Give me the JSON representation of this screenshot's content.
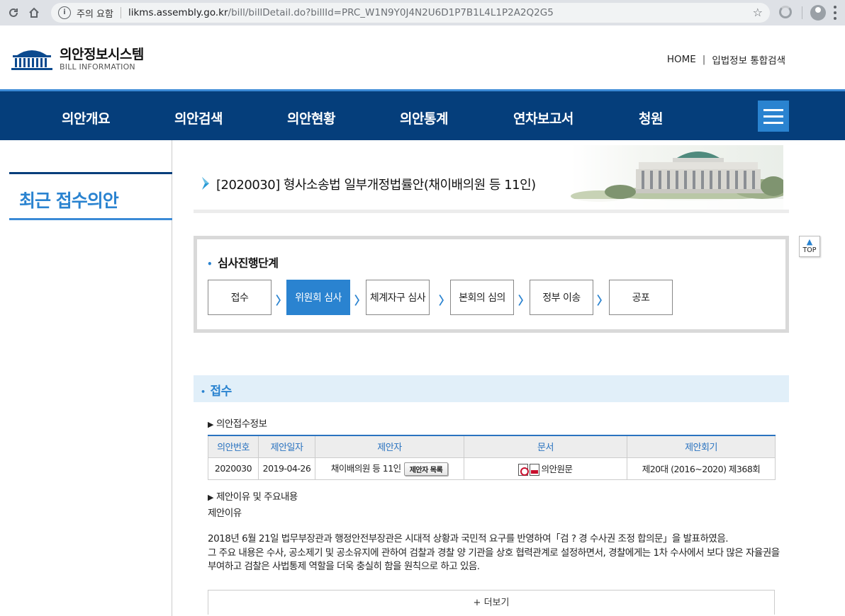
{
  "browser": {
    "warning": "주의 요함",
    "url_host": "likms.assembly.go.kr",
    "url_path": "/bill/billDetail.do?billId=PRC_W1N9Y0J4N2U6D1P7B1L4L1P2A2Q2G5"
  },
  "header": {
    "logo_kr": "의안정보시스템",
    "logo_en": "BILL INFORMATION",
    "util_links": [
      "HOME",
      "|",
      "입법정보 통합검색"
    ]
  },
  "gnb": {
    "items": [
      "의안개요",
      "의안검색",
      "의안현황",
      "의안통계",
      "연차보고서",
      "청원"
    ]
  },
  "lnb": {
    "title": "최근 접수의안"
  },
  "bill": {
    "title": "[2020030] 형사소송법 일부개정법률안(채이배의원 등 11인)"
  },
  "top_button": "TOP",
  "stage": {
    "label": "심사진행단계",
    "steps": [
      "접수",
      "위원회 심사",
      "체계자구 심사",
      "본회의 심의",
      "정부 이송",
      "공포"
    ],
    "active_index": 1,
    "arrow": "〉"
  },
  "section": {
    "title": "접수",
    "sub1": "의안접수정보",
    "table": {
      "headers": [
        "의안번호",
        "제안일자",
        "제안자",
        "문서",
        "제안회기"
      ],
      "row": {
        "bill_no": "2020030",
        "date": "2019-04-26",
        "proposer": "채이배의원 등 11인",
        "proposer_btn": "제안자 목록",
        "document": "의안원문",
        "session": "제20대 (2016~2020) 제368회"
      }
    },
    "sub2": "제안이유 및 주요내용",
    "reason_label": "제안이유",
    "reason_lines": [
      "2018년 6월 21일 법무부장관과 행정안전부장관은 시대적 상황과 국민적 요구를 반영하여「검 ? 경 수사권 조정 합의문」을 발표하였음.",
      "그 주요 내용은 수사, 공소제기 및 공소유지에 관하여 검찰과 경찰 양 기관을 상호 협력관계로 설정하면서, 경찰에게는 1차 수사에서 보다 많은 자율권을",
      "부여하고 검찰은 사법통제 역할을 더욱 충실히 함을 원칙으로 하고 있음."
    ],
    "more": "+ 더보기"
  },
  "colors": {
    "navy": "#053e7b",
    "accent": "#2a83d0",
    "section_bg": "#e1eff9"
  }
}
